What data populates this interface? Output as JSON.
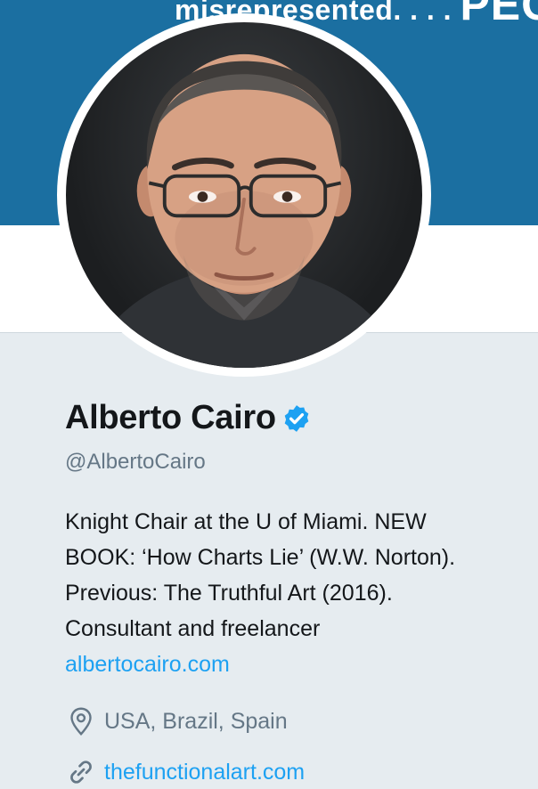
{
  "header": {
    "banner_text_small": "misrepresented. . . .",
    "banner_text_big": "PEOP",
    "banner_color": "#1b6fa1"
  },
  "profile": {
    "name": "Alberto Cairo",
    "verified": true,
    "handle": "@AlbertoCairo",
    "bio_lines": [
      "Knight Chair at the U of Miami. NEW",
      "BOOK: ‘How Charts Lie’ (W.W. Norton).",
      "Previous: The Truthful Art (2016).",
      "Consultant and freelancer"
    ],
    "bio_link": "albertocairo.com",
    "location": "USA, Brazil, Spain",
    "website": "thefunctionalart.com"
  },
  "icons": {
    "verified": "verified-badge-icon",
    "location": "location-pin-icon",
    "website": "link-icon"
  },
  "colors": {
    "link": "#1da1f2",
    "secondary_text": "#657786",
    "primary_text": "#14171a",
    "background": "#e6ecf0"
  }
}
